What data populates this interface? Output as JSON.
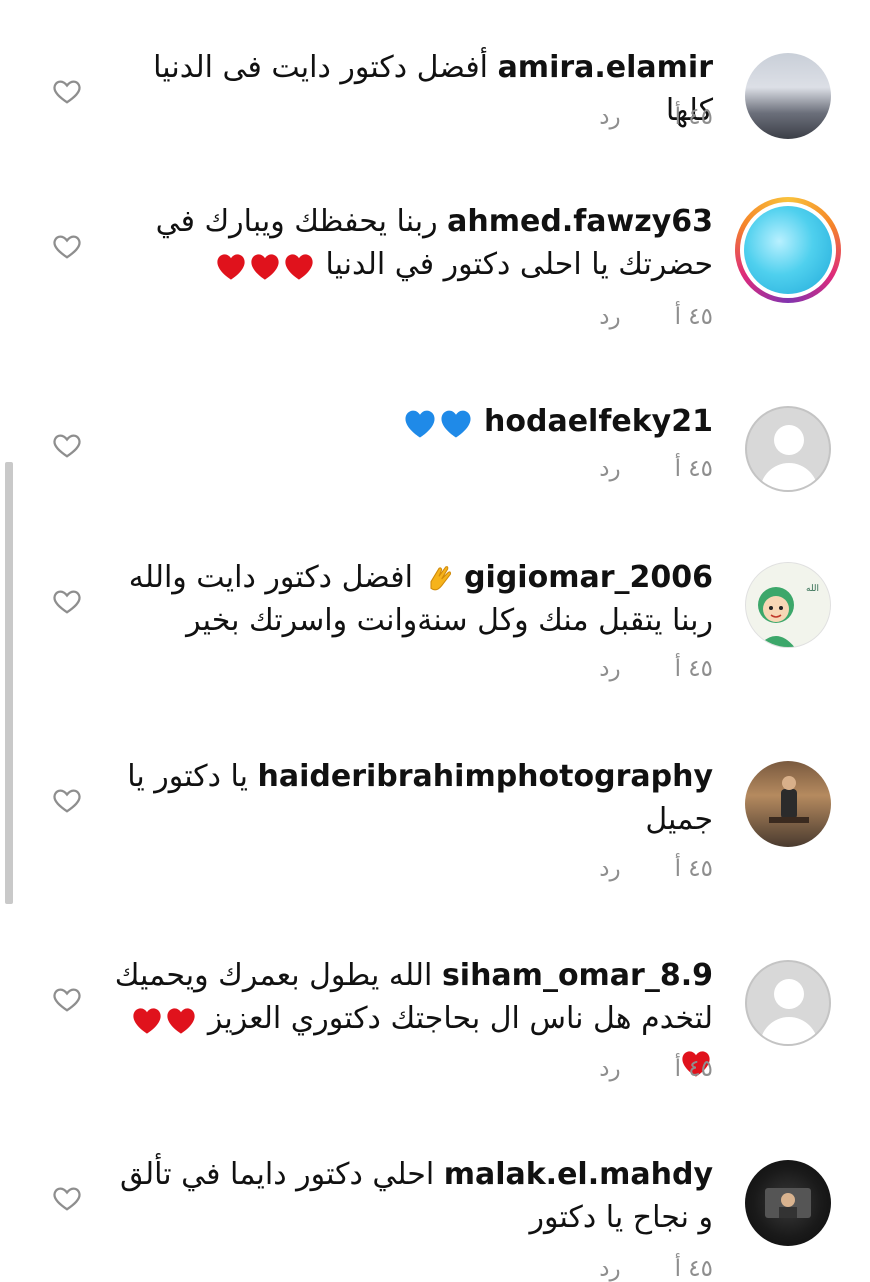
{
  "comments": [
    {
      "username": "amira.elamir",
      "text": "أفضل دكتور دايت فى الدنيا كلها",
      "emojis": [],
      "time": "٤٥ أ",
      "reply": "رد",
      "avatar": "photo"
    },
    {
      "username": "ahmed.fawzy63",
      "text": "ربنا يحفظك ويبارك في حضرتك يا احلى دكتور في الدنيا",
      "emojis": [
        "red-heart",
        "red-heart",
        "red-heart"
      ],
      "time": "٤٥ أ",
      "reply": "رد",
      "avatar": "story-ring"
    },
    {
      "username": "hodaelfeky21",
      "text": "",
      "emojis": [
        "blue-heart",
        "blue-heart"
      ],
      "time": "٤٥ أ",
      "reply": "رد",
      "avatar": "default"
    },
    {
      "username": "gigiomar_2006",
      "text": "افضل دكتور دايت والله ربنا يتقبل منك وكل سنةوانت واسرتك بخير",
      "emojis_before": [
        "clapping-hands"
      ],
      "time": "٤٥ أ",
      "reply": "رد",
      "avatar": "photo"
    },
    {
      "username": "haideribrahimphotography",
      "text": "يا دكتور يا جميل",
      "emojis": [],
      "time": "٤٥ أ",
      "reply": "رد",
      "avatar": "photo"
    },
    {
      "username": "siham_omar_8.9",
      "text": "الله يطول بعمرك ويحميك لتخدم هل ناس ال بحاجتك دكتوري العزيز",
      "emojis": [
        "red-heart",
        "red-heart",
        "red-heart"
      ],
      "time": "٤٥ أ",
      "reply": "رد",
      "avatar": "default"
    },
    {
      "username": "malak.el.mahdy",
      "text": "احلي دكتور دايما في تألق و نجاح يا دكتور",
      "emojis": [],
      "time": "٤٥ أ",
      "reply": "رد",
      "avatar": "photo"
    }
  ],
  "colors": {
    "meta": "#8e8e8e",
    "text": "#111111",
    "red-heart": "#e0121c",
    "blue-heart": "#1f8ae8"
  }
}
